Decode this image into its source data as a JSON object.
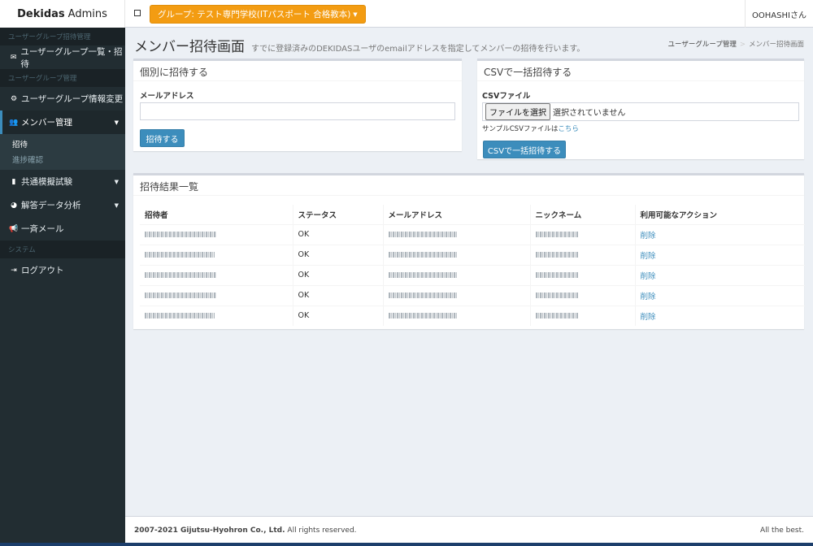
{
  "brand": {
    "bold": "Dekidas",
    "rest": "Admins"
  },
  "header": {
    "group_button": "グループ: テスト専門学校(ITパスポート 合格教本)",
    "user": "OOHASHIさん"
  },
  "sidebar": {
    "section1": "ユーザーグループ招待管理",
    "item_group_list": "ユーザーグループ一覧・招待",
    "section2": "ユーザーグループ管理",
    "item_group_edit": "ユーザーグループ情報変更",
    "item_members": "メンバー管理",
    "sub_invite": "招待",
    "sub_progress": "進捗確認",
    "item_exam": "共通模擬試験",
    "item_analysis": "解答データ分析",
    "item_mail": "一斉メール",
    "section3": "システム",
    "item_logout": "ログアウト"
  },
  "page": {
    "title": "メンバー招待画面",
    "description": "すでに登録済みのDEKIDASユーザのemailアドレスを指定してメンバーの招待を行います。",
    "breadcrumb_root": "ユーザーグループ管理",
    "breadcrumb_current": "メンバー招待画面"
  },
  "individual": {
    "title": "個別に招待する",
    "email_label": "メールアドレス",
    "email_value": "",
    "submit": "招待する"
  },
  "csv": {
    "title": "CSVで一括招待する",
    "file_label": "CSVファイル",
    "choose_button": "ファイルを選択",
    "no_file": "選択されていません",
    "sample_text": "サンプルCSVファイルは",
    "sample_link": "こちら",
    "submit": "CSVで一括招待する"
  },
  "results": {
    "title": "招待結果一覧",
    "columns": [
      "招待者",
      "ステータス",
      "メールアドレス",
      "ニックネーム",
      "利用可能なアクション"
    ],
    "rows": [
      {
        "status": "OK",
        "action": "削除"
      },
      {
        "status": "OK",
        "action": "削除"
      },
      {
        "status": "OK",
        "action": "削除"
      },
      {
        "status": "OK",
        "action": "削除"
      },
      {
        "status": "OK",
        "action": "削除"
      }
    ]
  },
  "footer": {
    "copyright": "2007-2021 Gijutsu-Hyohron Co., Ltd.",
    "rights": " All rights reserved.",
    "tagline": "All the best."
  }
}
